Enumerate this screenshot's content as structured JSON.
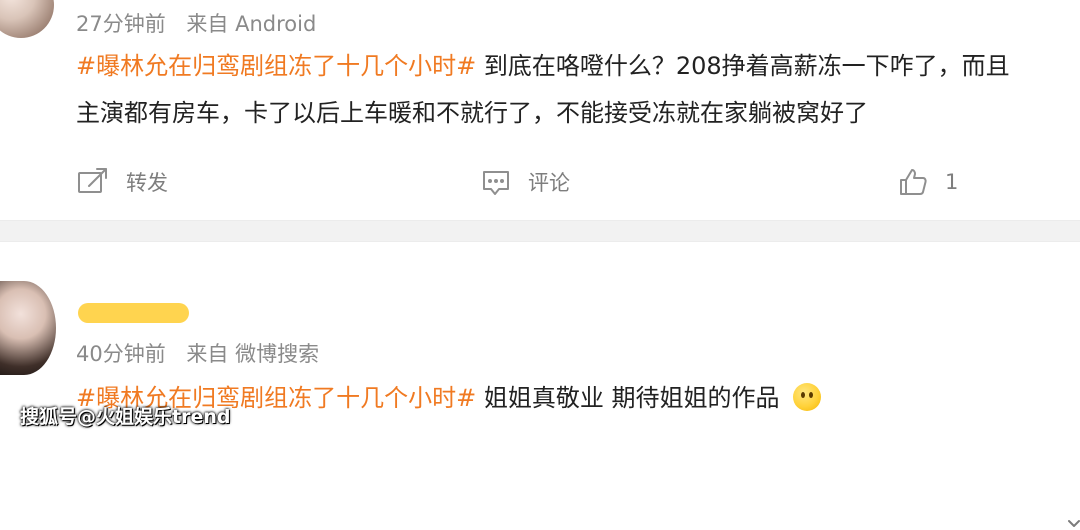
{
  "posts": [
    {
      "meta": {
        "time": "27分钟前",
        "source": "来自 Android"
      },
      "text": {
        "hashtag": "#曝林允在归鸾剧组冻了十几个小时#",
        "line1": "到底在咯噔什么？208挣着高薪冻一下咋了，而且",
        "line2": "主演都有房车，卡了以后上车暖和不就行了，不能接受冻就在家躺被窝好了"
      },
      "actions": {
        "repost_label": "转发",
        "comment_label": "评论",
        "like_count": "1"
      }
    },
    {
      "meta": {
        "time": "40分钟前",
        "source": "来自 微博搜索"
      },
      "text": {
        "hashtag": "#曝林允在归鸾剧组冻了十几个小时#",
        "line1": "姐姐真敬业 期待姐姐的作品"
      }
    }
  ],
  "watermark": "搜狐号@火姐娱乐trend",
  "icons": {
    "repost": "repost-icon",
    "comment": "comment-icon",
    "like": "like-icon",
    "emoji": "emoji-icon",
    "chevron": "chevron-down-icon"
  },
  "colors": {
    "hashtag": "#f07a22",
    "meta": "#8a8a8a",
    "action": "#7e7e7e",
    "divider": "#f2f2f2"
  }
}
